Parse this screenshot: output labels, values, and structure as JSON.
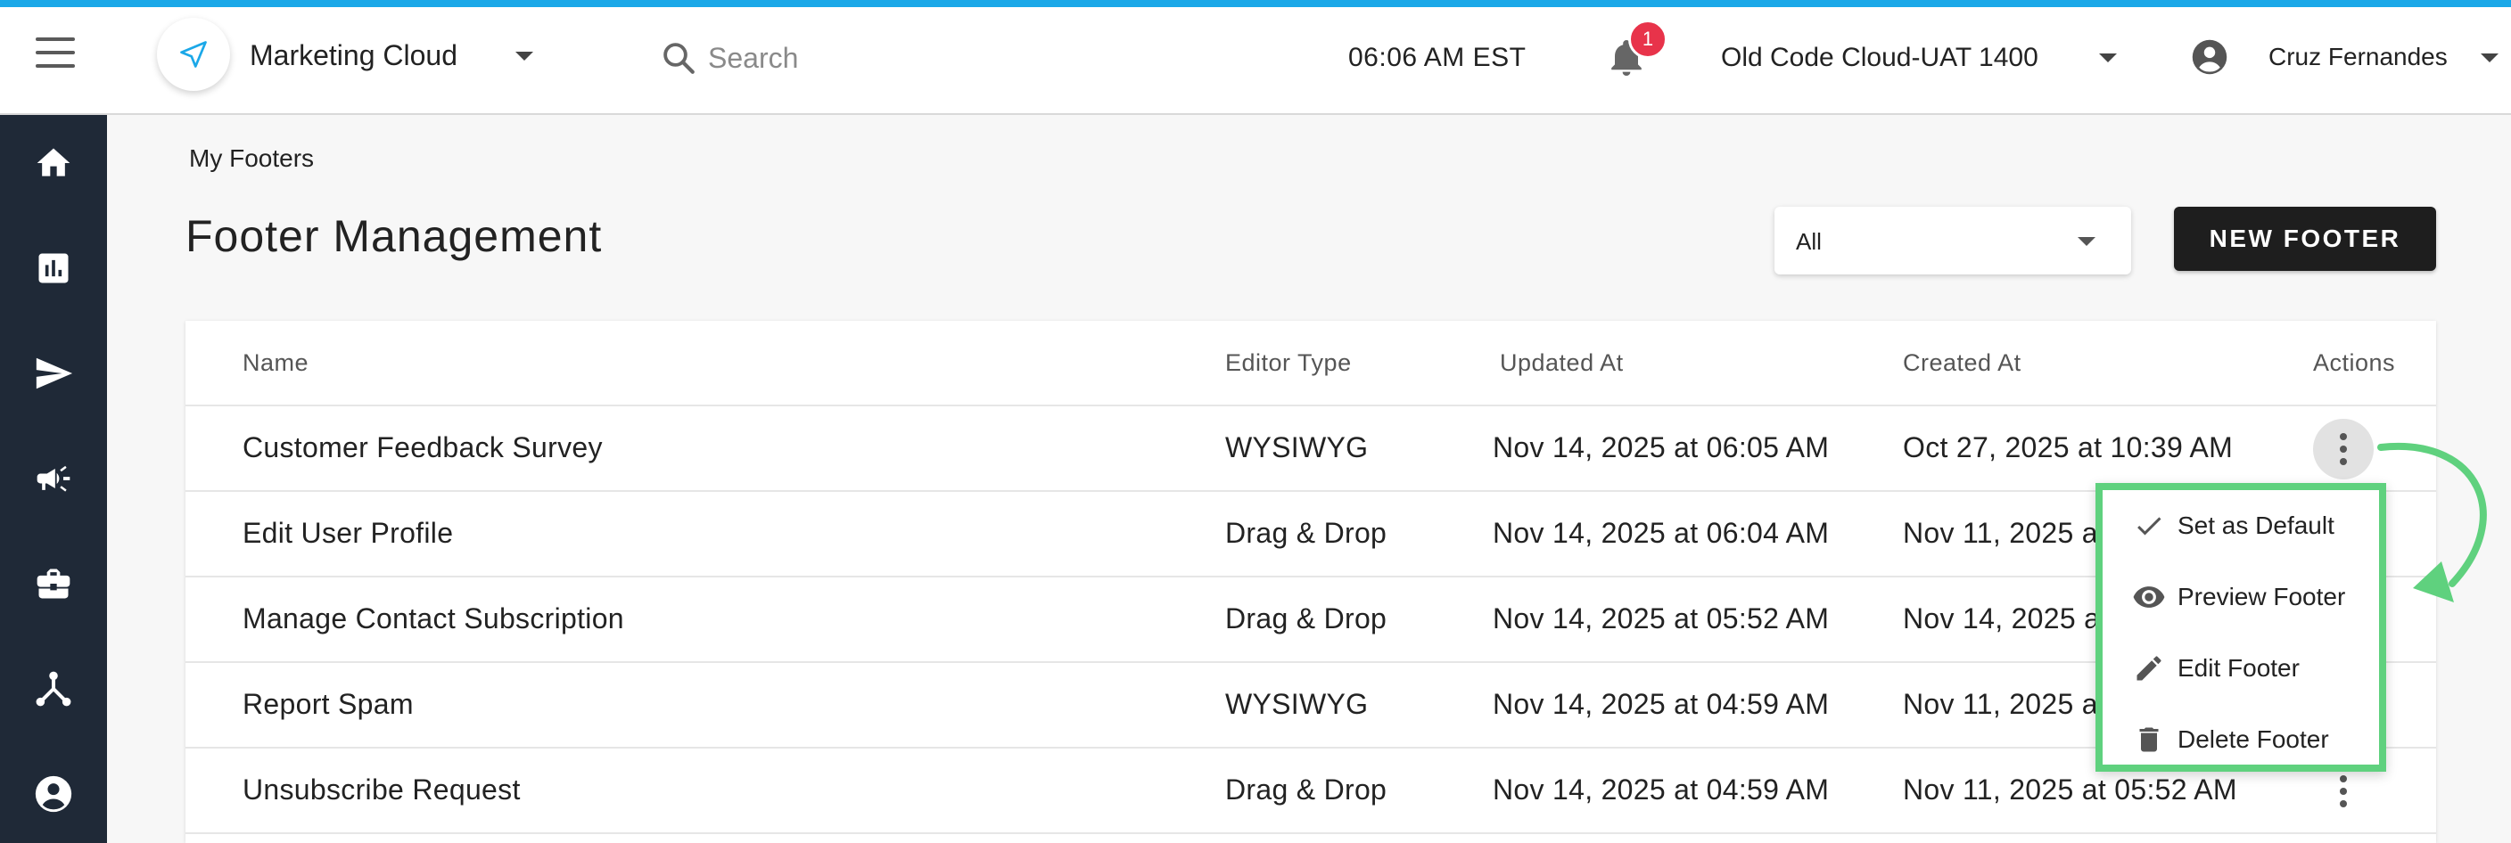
{
  "app": {
    "name": "Marketing Cloud",
    "search_placeholder": "Search",
    "time": "06:06 AM EST",
    "notification_count": "1",
    "org_name": "Old Code Cloud-UAT 1400",
    "user_name": "Cruz Fernandes"
  },
  "sidebar": {
    "items": [
      {
        "icon": "home-icon"
      },
      {
        "icon": "analytics-icon"
      },
      {
        "icon": "send-icon"
      },
      {
        "icon": "campaign-icon"
      },
      {
        "icon": "briefcase-icon"
      },
      {
        "icon": "hierarchy-icon"
      },
      {
        "icon": "account-icon"
      }
    ]
  },
  "page": {
    "breadcrumb": "My Footers",
    "title": "Footer Management",
    "filter_value": "All",
    "new_button": "NEW FOOTER"
  },
  "table": {
    "columns": [
      "Name",
      "Editor Type",
      "Updated At",
      "Created At",
      "Actions"
    ],
    "rows": [
      {
        "name": "Customer Feedback Survey",
        "editor": "WYSIWYG",
        "updated": "Nov 14, 2025 at 06:05 AM",
        "created": "Oct 27, 2025 at 10:39 AM"
      },
      {
        "name": "Edit User Profile",
        "editor": "Drag & Drop",
        "updated": "Nov 14, 2025 at 06:04 AM",
        "created": "Nov 11, 2025 a"
      },
      {
        "name": "Manage Contact Subscription",
        "editor": "Drag & Drop",
        "updated": "Nov 14, 2025 at 05:52 AM",
        "created": "Nov 14, 2025 a"
      },
      {
        "name": "Report Spam",
        "editor": "WYSIWYG",
        "updated": "Nov 14, 2025 at 04:59 AM",
        "created": "Nov 11, 2025 a"
      },
      {
        "name": "Unsubscribe Request",
        "editor": "Drag & Drop",
        "updated": "Nov 14, 2025 at 04:59 AM",
        "created": "Nov 11, 2025 at 05:52 AM"
      }
    ]
  },
  "actions_menu": {
    "items": [
      {
        "label": "Set as Default",
        "icon": "check-icon"
      },
      {
        "label": "Preview Footer",
        "icon": "eye-icon"
      },
      {
        "label": "Edit Footer",
        "icon": "pencil-icon"
      },
      {
        "label": "Delete Footer",
        "icon": "trash-icon"
      }
    ],
    "highlight_color": "#5fd17e"
  },
  "colors": {
    "accent": "#1ba8e8",
    "sidebar": "#1f2937",
    "badge": "#e8334a",
    "button": "#1e1e1e"
  }
}
